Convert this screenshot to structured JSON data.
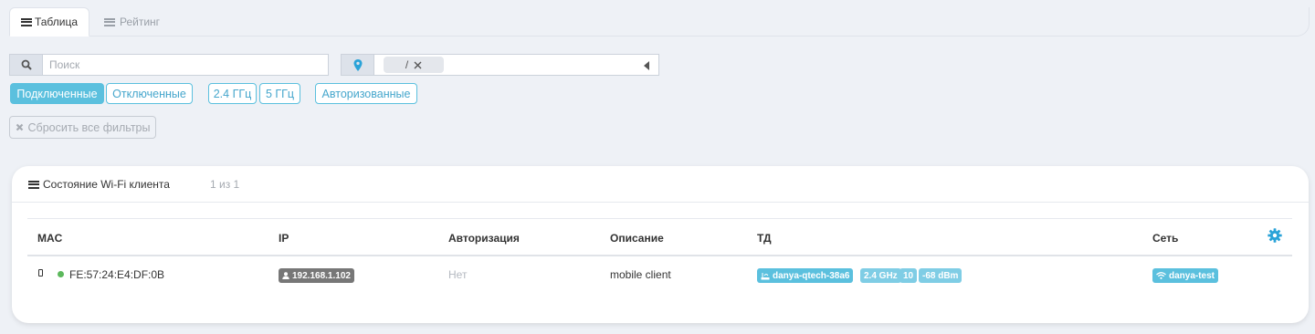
{
  "tabs": [
    {
      "label": "Таблица",
      "icon": "list-icon",
      "active": true
    },
    {
      "label": "Рейтинг",
      "icon": "list-icon",
      "active": false
    }
  ],
  "search": {
    "placeholder": "Поиск",
    "icon": "search-icon"
  },
  "location": {
    "chip_label": "/",
    "icon": "map-marker-icon"
  },
  "filters": {
    "connected": "Подключенные",
    "disconnected": "Отключенные",
    "band24": "2.4 ГГц",
    "band5": "5 ГГц",
    "authorized": "Авторизованные",
    "reset": "Сбросить все фильтры"
  },
  "card": {
    "title": "Состояние Wi-Fi клиента",
    "count": "1 из 1",
    "columns": {
      "mac": "MAC",
      "ip": "IP",
      "auth": "Авторизация",
      "desc": "Описание",
      "ap": "ТД",
      "net": "Сеть"
    },
    "rows": [
      {
        "mac": "FE:57:24:E4:DF:0B",
        "ip": "192.168.1.102",
        "auth": "Нет",
        "desc": "mobile client",
        "ap": "danya-qtech-38a6",
        "band": "2.4 GHz",
        "channel": "10",
        "rssi": "-68 dBm",
        "net": "danya-test",
        "status_color": "#5cb85c"
      }
    ]
  },
  "colors": {
    "accent": "#5bc0de",
    "gear": "#2aa3d8"
  }
}
